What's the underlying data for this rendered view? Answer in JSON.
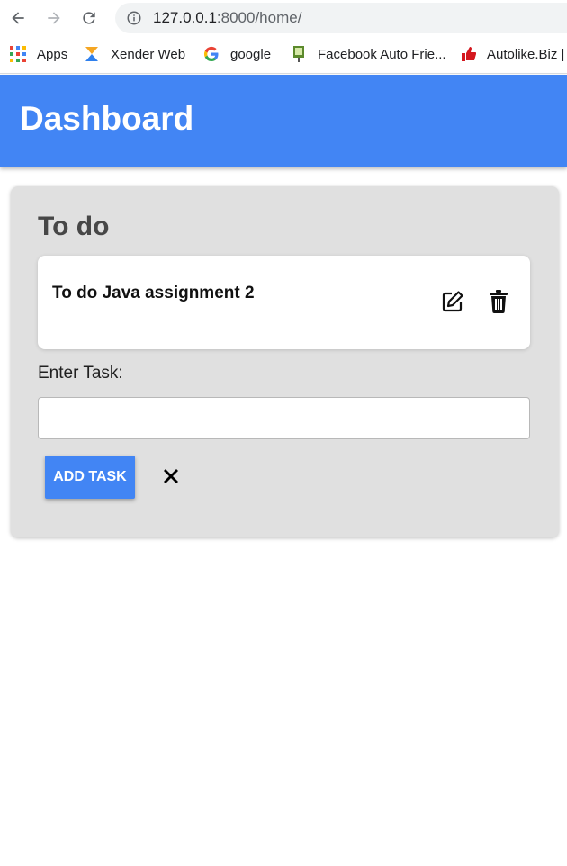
{
  "browser": {
    "url_host": "127.0.0.1",
    "url_rest": ":8000/home/",
    "bookmarks": [
      {
        "label": "Apps",
        "icon": "apps-grid-icon"
      },
      {
        "label": "Xender Web",
        "icon": "xender-icon"
      },
      {
        "label": "google",
        "icon": "google-icon"
      },
      {
        "label": "Facebook Auto Frie...",
        "icon": "facebook-auto-icon"
      },
      {
        "label": "Autolike.Biz |",
        "icon": "autolike-icon"
      }
    ]
  },
  "header": {
    "title": "Dashboard"
  },
  "todo": {
    "title": "To do",
    "items": [
      {
        "text": "To do Java assignment 2"
      }
    ],
    "input_label": "Enter Task:",
    "input_value": "",
    "input_placeholder": "",
    "add_button": "ADD TASK"
  },
  "colors": {
    "header_bg": "#4285f4",
    "card_bg": "#e0e0e0",
    "button_bg": "#4285f4"
  }
}
